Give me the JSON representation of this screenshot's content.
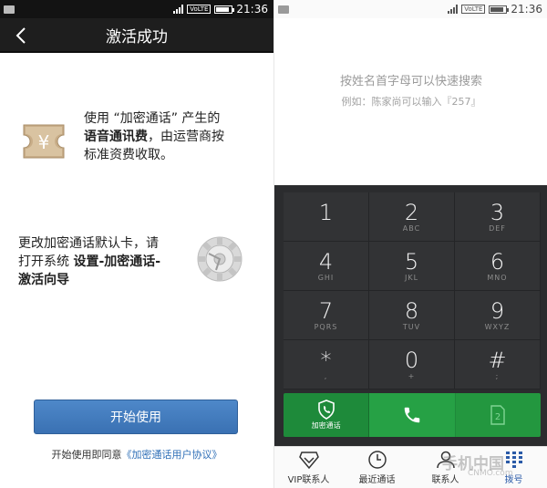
{
  "status_bar": {
    "network": "VoLTE",
    "time": "21:36"
  },
  "activation": {
    "title": "激活成功",
    "info1": {
      "prefix": "使用 “加密通话” 产生的",
      "bold": "语音通讯费",
      "middle": "，由运营商按",
      "line3": "标准资费收取。"
    },
    "info2": {
      "line1": "更改加密通话默认卡，请",
      "line2_prefix": "打开系统 ",
      "line2_bold": "设置-加密通话-",
      "line3_bold": "激活向导"
    },
    "start_button": "开始使用",
    "agreement_prefix": "开始使用即同意",
    "agreement_link": "《加密通话用户协议》"
  },
  "dialer": {
    "hint_title": "按姓名首字母可以快速搜索",
    "hint_example": "例如：陈家尚可以输入『257』",
    "keys": [
      {
        "digit": "1",
        "letters": ""
      },
      {
        "digit": "2",
        "letters": "ABC"
      },
      {
        "digit": "3",
        "letters": "DEF"
      },
      {
        "digit": "4",
        "letters": "GHI"
      },
      {
        "digit": "5",
        "letters": "JKL"
      },
      {
        "digit": "6",
        "letters": "MNO"
      },
      {
        "digit": "7",
        "letters": "PQRS"
      },
      {
        "digit": "8",
        "letters": "TUV"
      },
      {
        "digit": "9",
        "letters": "WXYZ"
      },
      {
        "digit": "*",
        "letters": ","
      },
      {
        "digit": "0",
        "letters": "+"
      },
      {
        "digit": "#",
        "letters": ";"
      }
    ],
    "encrypted_call_label": "加密通话",
    "sim_label": "2",
    "nav": [
      {
        "label": "VIP联系人",
        "icon": "vip-contacts-icon"
      },
      {
        "label": "最近通话",
        "icon": "recent-calls-icon"
      },
      {
        "label": "联系人",
        "icon": "contacts-icon"
      },
      {
        "label": "拨号",
        "icon": "dialpad-icon"
      }
    ],
    "active_nav": "拨号"
  },
  "watermark": {
    "brand": "手机中国",
    "sub": "CNMO.com"
  },
  "colors": {
    "title_bar": "#1e1e1e",
    "primary_button": "#3a71b3",
    "link": "#2f6fb7",
    "keypad_bg": "#2b2c2e",
    "call_green": "#26a145",
    "nav_active": "#2a5aa8"
  }
}
